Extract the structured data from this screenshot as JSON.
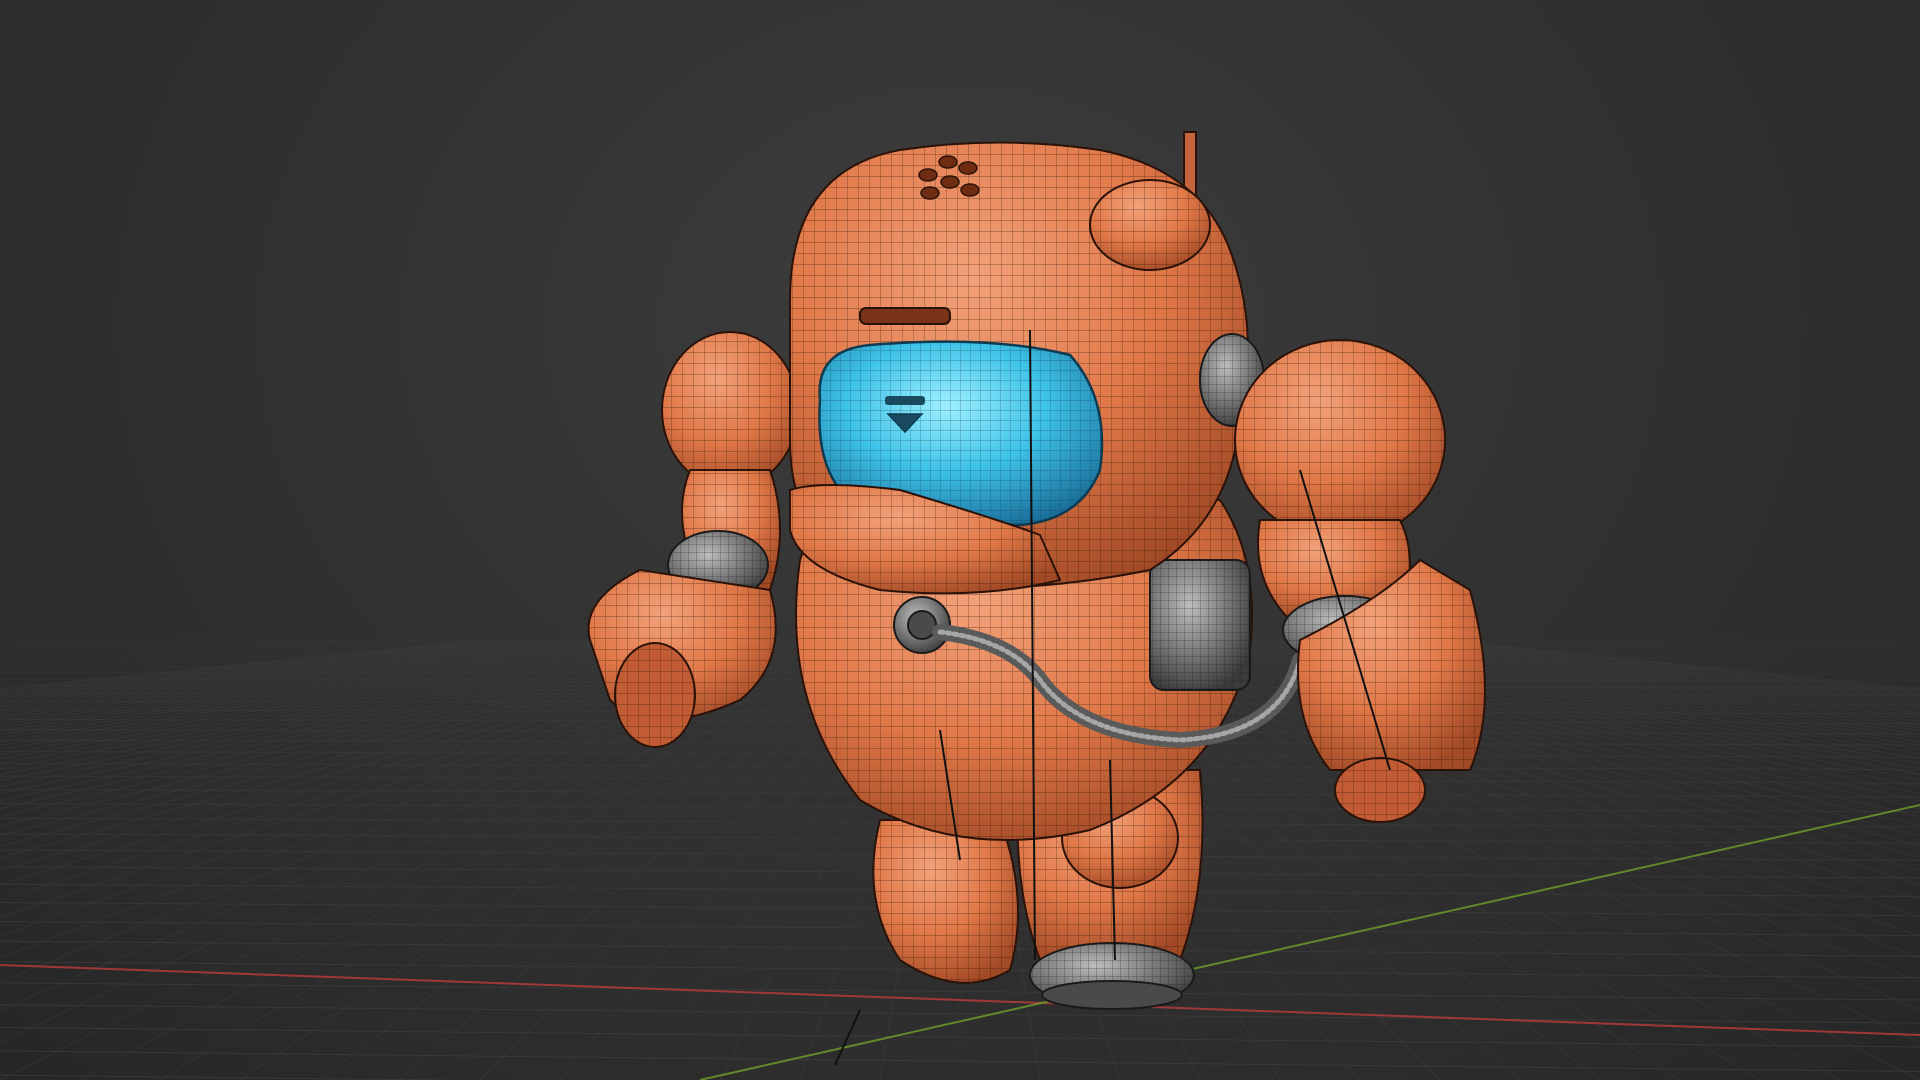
{
  "viewport": {
    "background_color": "#333333",
    "grid_color": "#3f3f3f",
    "x_axis_color": "#b43a3a",
    "y_axis_color": "#6a9a2a",
    "shading_mode": "wireframe-overlay"
  },
  "scene": {
    "object_icon": "mech-robot-model",
    "body_color": "#e07848",
    "body_shadow_color": "#b5522d",
    "visor_color": "#3ec3e8",
    "joint_color": "#6d6d6d",
    "wire_color": "#2b1208"
  }
}
